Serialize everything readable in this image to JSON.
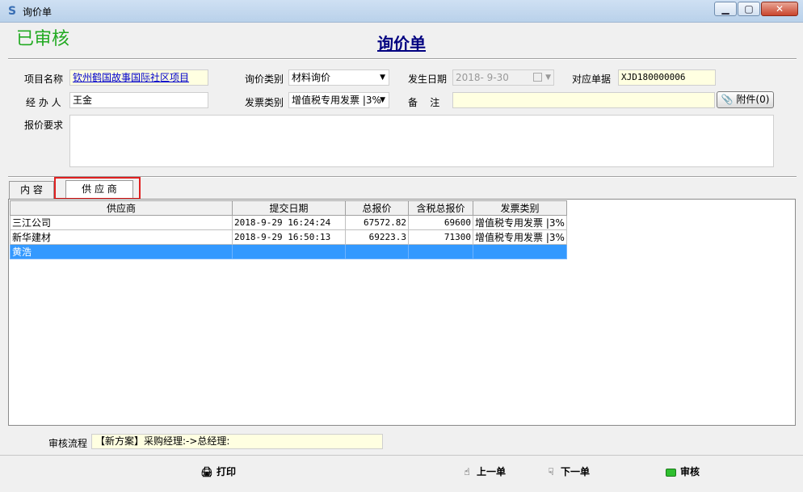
{
  "window": {
    "title": "询价单",
    "btn_min": "▁",
    "btn_max": "▢",
    "btn_close": "✕"
  },
  "status": "已审核",
  "form_title": "询价单",
  "fields": {
    "project_label": "项目名称",
    "project_value": "钦州鹤国故事国际社区项目",
    "inquiry_type_label": "询价类别",
    "inquiry_type_value": "材料询价",
    "date_label": "发生日期",
    "date_value": "2018- 9-30",
    "ref_label": "对应单据",
    "ref_value": "XJD180000006",
    "handler_label": "经 办 人",
    "handler_value": "王金",
    "invoice_label": "发票类别",
    "invoice_value": "增值税专用发票 |3%",
    "remark_label": "备    注",
    "remark_value": "",
    "attach_label": "附件(0)",
    "requirement_label": "报价要求"
  },
  "tabs": [
    {
      "label": "内  容"
    },
    {
      "label": "供 应 商"
    }
  ],
  "table": {
    "headers": [
      "供应商",
      "提交日期",
      "总报价",
      "含税总报价",
      "发票类别"
    ],
    "rows": [
      [
        "三江公司",
        "2018-9-29 16:24:24",
        "67572.82",
        "69600",
        "增值税专用发票 |3%"
      ],
      [
        "新华建材",
        "2018-9-29 16:50:13",
        "69223.3",
        "71300",
        "增值税专用发票 |3%"
      ],
      [
        "黄浩",
        "",
        "",
        "",
        ""
      ]
    ]
  },
  "flow": {
    "label": "审核流程",
    "value": "【新方案】采购经理:->总经理:"
  },
  "toolbar": {
    "print": "打印",
    "prev": "上一单",
    "next": "下一单",
    "approve": "审核"
  },
  "colors": {
    "status": "#22aa22",
    "title": "#000080",
    "selected_row": "#3399ff",
    "highlight": "#e02020"
  }
}
